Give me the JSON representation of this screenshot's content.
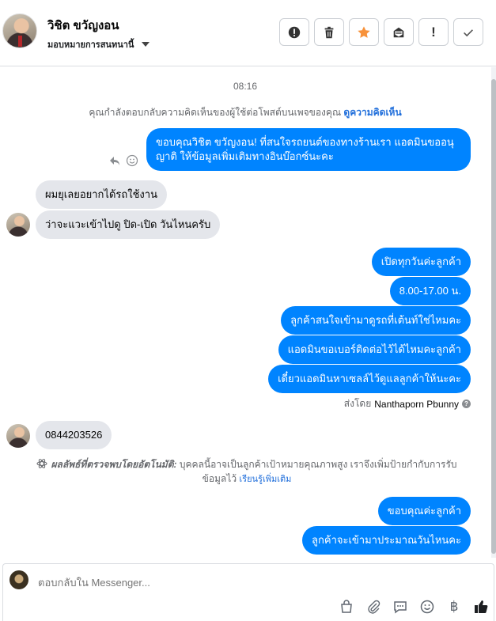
{
  "header": {
    "contact_name": "วิชิต ขวัญงอน",
    "assign_label": "มอบหมายการสนทนานี้",
    "actions": [
      {
        "name": "spam-button",
        "icon": "exclamation-circle-icon"
      },
      {
        "name": "delete-button",
        "icon": "trash-icon"
      },
      {
        "name": "star-button",
        "icon": "star-icon"
      },
      {
        "name": "mark-unread-button",
        "icon": "envelope-icon"
      },
      {
        "name": "follow-up-button",
        "icon": "exclamation-icon",
        "glyph": "!"
      },
      {
        "name": "done-button",
        "icon": "check-icon"
      }
    ]
  },
  "conversation": {
    "timestamp": "08:16",
    "reply_note_text": "คุณกำลังตอบกลับความคิดเห็นของผู้ใช้ต่อโพสต์บนเพจของคุณ",
    "reply_note_link": "ดูความคิดเห็น",
    "messages": {
      "m1_line1": "ขอบคุณวิชิต ขวัญงอน! ที่สนใจรถยนต์ของทางร้านเรา แอดมินขออนุ",
      "m1_line2": "ญาติ ให้ข้อมูลเพิ่มเติมทางอินบ๊อกซ์นะคะ",
      "m2": "ผมยุเลยอยากได้รถใช้งาน",
      "m3": "ว่าจะแวะเข้าไปดู ปิด-เปิด วันไหนครับ",
      "m4": "เปิดทุกวันค่ะลูกค้า",
      "m5": "8.00-17.00 น.",
      "m6": "ลูกค้าสนใจเข้ามาดูรถที่เต้นท์ใช่ไหมคะ",
      "m7": "แอดมินขอเบอร์ติดต่อไว้ได้ไหมคะลูกค้า",
      "m8": "เดี๋ยวแอดมินหาเซลล์ไว้ดูแลลูกค้าให้นะคะ",
      "m9": "0844203526",
      "m10": "ขอบคุณค่ะลูกค้า",
      "m11": "ลูกค้าจะเข้ามาประมาณวันไหนคะ"
    },
    "sent_by_prefix": "ส่งโดย",
    "sent_by_name": "Nanthaporn Pbunny",
    "auto_detect_title": "ผลลัพธ์ที่ตรวจพบโดยอัตโนมัติ:",
    "auto_detect_text": "บุคคลนี้อาจเป็นลูกค้าเป้าหมายคุณภาพสูง เราจึงเพิ่มป้ายกำกับการรับ",
    "auto_detect_text2": "ข้อมูลไว้",
    "auto_detect_link": "เรียนรู้เพิ่มเติม"
  },
  "composer": {
    "placeholder": "ตอบกลับใน Messenger...",
    "tools": [
      "shop-icon",
      "attachment-icon",
      "saved-reply-icon",
      "emoji-icon",
      "baht-icon",
      "like-icon"
    ],
    "baht_glyph": "฿"
  },
  "colors": {
    "outgoing_bubble": "#0084ff",
    "incoming_bubble": "#e4e6eb",
    "star": "#f7923b",
    "link": "#216fdb"
  }
}
